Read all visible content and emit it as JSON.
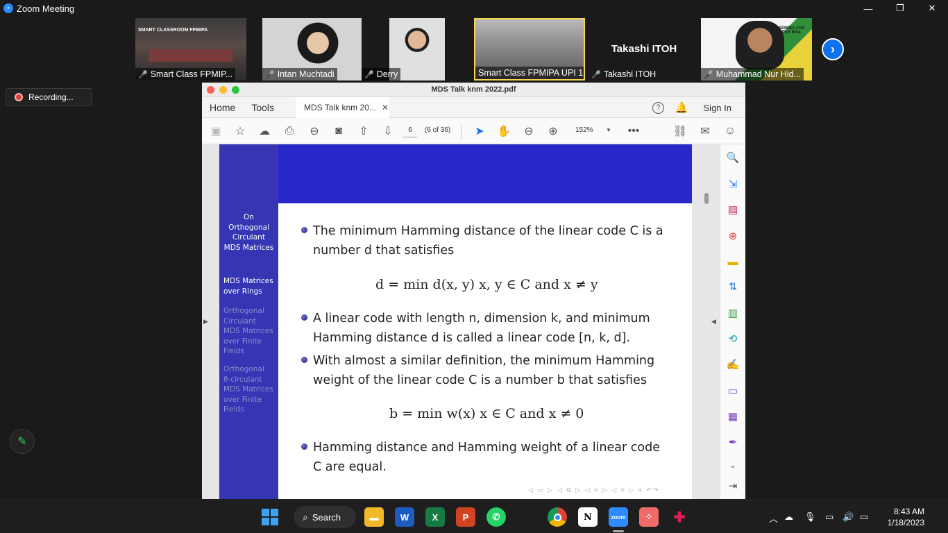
{
  "zoom": {
    "window_title": "Zoom Meeting",
    "recording_label": "Recording...",
    "participants": [
      {
        "name": "Smart Class FPMIP...",
        "banner": "SMART CLASSROOM FPMIPA"
      },
      {
        "name": "Intan Muchtadi"
      },
      {
        "name": "Derry"
      },
      {
        "name": "Smart Class FPMIPA UPI 1"
      },
      {
        "name": "Takashi ITOH",
        "big_name": "Takashi ITOH"
      },
      {
        "name": "Muhammad Nur Hid...",
        "banner": "SEMINA AND OPER BRA"
      }
    ]
  },
  "acrobat": {
    "window_title": "MDS Talk knm 2022.pdf",
    "menu": {
      "home": "Home",
      "tools": "Tools",
      "doc_tab": "MDS Talk knm 20...",
      "sign_in": "Sign In"
    },
    "toolbar": {
      "page": "6",
      "page_of": "(6 of 36)",
      "zoom": "152%"
    }
  },
  "slide": {
    "sidebar": {
      "title": [
        "On",
        "Orthogonal",
        "Circulant",
        "MDS Matrices"
      ],
      "current": [
        "MDS Matrices",
        "over Rings"
      ],
      "item1": [
        "Orthogonal",
        "Circulant",
        "MDS Matrices",
        "over Finite",
        "Fields"
      ],
      "item2": [
        "Orthogonal",
        "θ-circulant",
        "MDS Matrices",
        "over Finite",
        "Fields"
      ]
    },
    "b1_l1": "The minimum Hamming distance of the linear code C is a",
    "b1_l2": "number d that satisfies",
    "eq1": "d = min d(x, y)        x, y ∈ C and x ≠ y",
    "b2_l1": "A linear code with length n, dimension k, and minimum",
    "b2_l2": "Hamming distance d is called a linear code [n, k, d].",
    "b3_l1": "With almost a similar definition, the minimum Hamming",
    "b3_l2": "weight of the linear code C is a number b that satisfies",
    "eq2": "b = min w(x)        x ∈ C and x ≠ 0",
    "b4_l1": "Hamming distance and Hamming weight of a linear code",
    "b4_l2": "C are equal."
  },
  "taskbar": {
    "search_label": "Search",
    "time": "8:43 AM",
    "date": "1/18/2023"
  },
  "colors": {
    "slide_sidebar": "#3636b4",
    "slide_header": "#2828c8",
    "zoom_accent": "#0e72ed"
  }
}
